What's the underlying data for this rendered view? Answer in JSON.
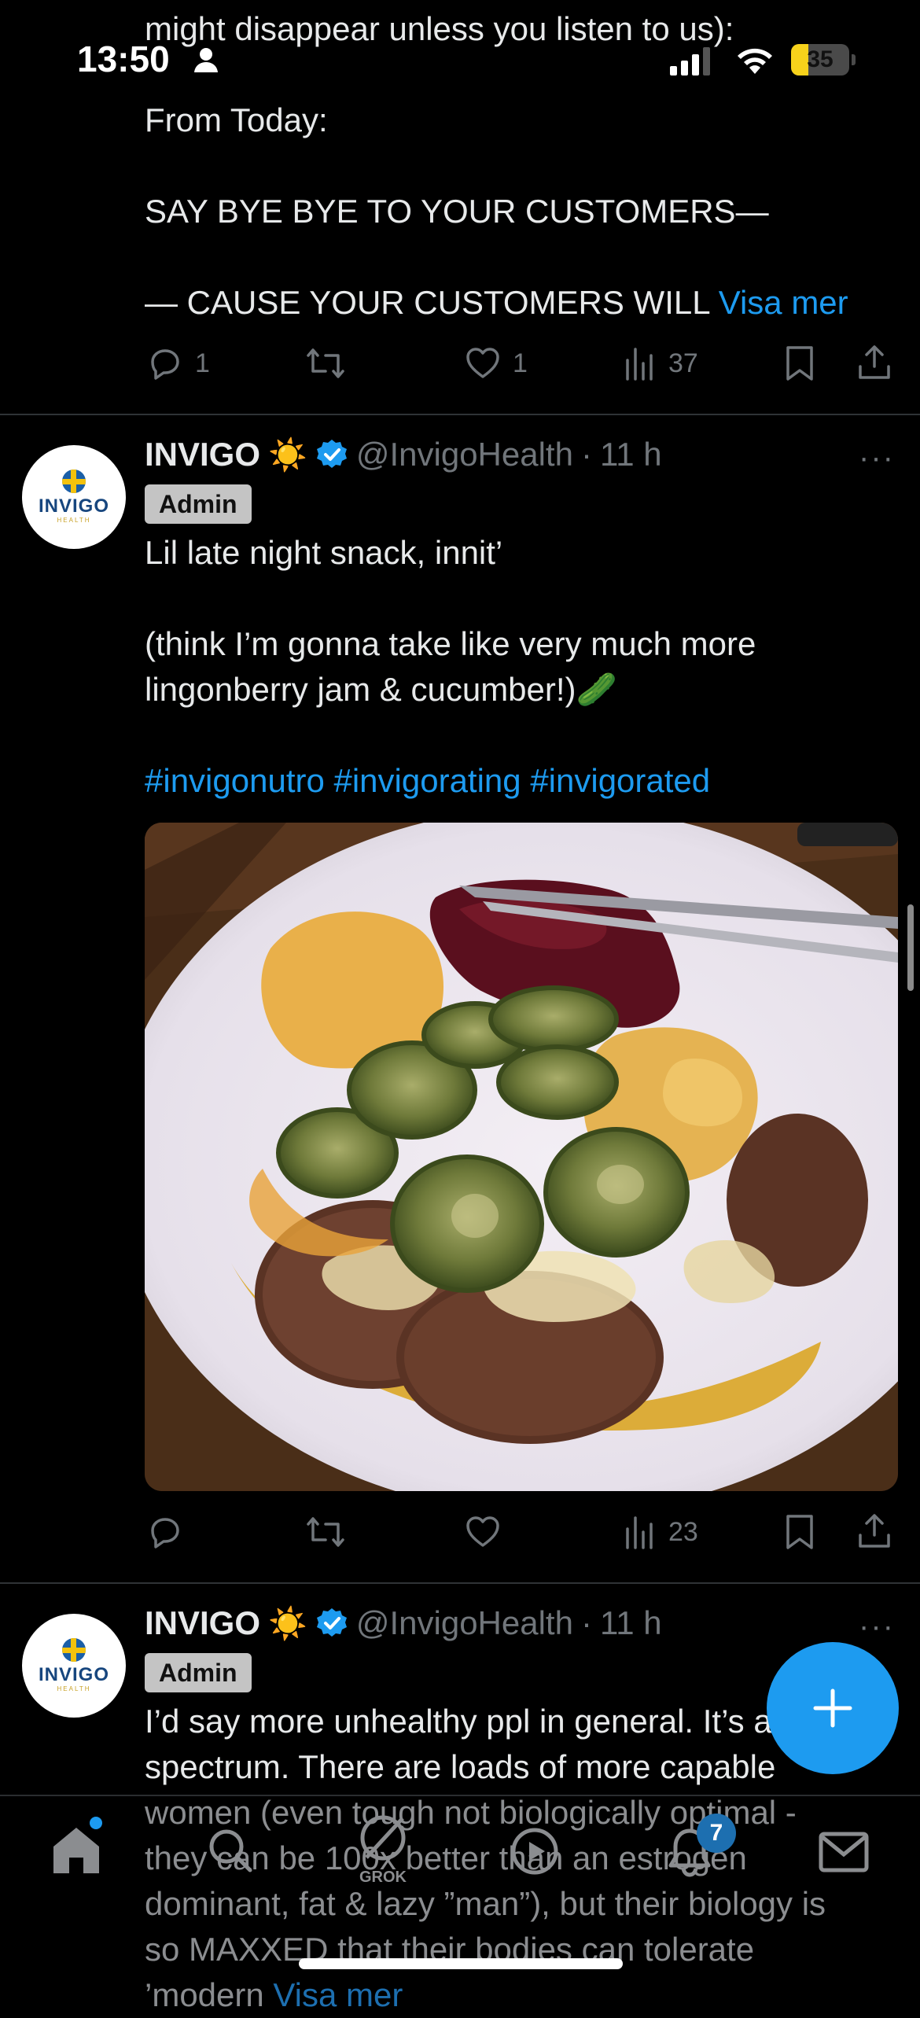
{
  "status_bar": {
    "time": "13:50",
    "battery": "35"
  },
  "prev_tweet": {
    "lines": [
      "might disappear unless you listen to us):",
      "From Today:",
      "SAY BYE BYE TO YOUR CUSTOMERS—",
      "— CAUSE YOUR CUSTOMERS WILL"
    ],
    "show_more": "Visa mer",
    "replies": "1",
    "likes": "1",
    "views": "37"
  },
  "tweet1": {
    "avatar": {
      "brand": "INVIGO",
      "sub": "HEALTH"
    },
    "name": "INVIGO",
    "emoji": "☀️",
    "handle": "@InvigoHealth",
    "dot": "·",
    "time": "11 h",
    "badge": "Admin",
    "line1": "Lil late night snack, innit’",
    "line2": "(think I’m gonna take like very much more",
    "line3": "lingonberry jam & cucumber!)🥒",
    "hashtags": "#invigonutro #invigorating #invigorated",
    "views": "23",
    "more": "···"
  },
  "tweet2": {
    "avatar": {
      "brand": "INVIGO",
      "sub": "HEALTH"
    },
    "name": "INVIGO",
    "emoji": "☀️",
    "handle": "@InvigoHealth",
    "dot": "·",
    "time": "11 h",
    "badge": "Admin",
    "lines": [
      "I’d say more unhealthy ppl in general. It’s all a",
      "spectrum. There are loads of more capable",
      "women (even tough not biologically optimal -",
      "they can be 100x better than an estrogen",
      "dominant, fat & lazy ”man”), but their biology is",
      "so MAXXED that their bodies can tolerate",
      "’modern"
    ],
    "show_more": "Visa mer",
    "more": "···"
  },
  "nav": {
    "grok_label": "GROK",
    "notifications_count": "7"
  },
  "colors": {
    "accent": "#1d9bf0",
    "background": "#000000",
    "text": "#e7e9ea",
    "muted": "#71767b"
  }
}
